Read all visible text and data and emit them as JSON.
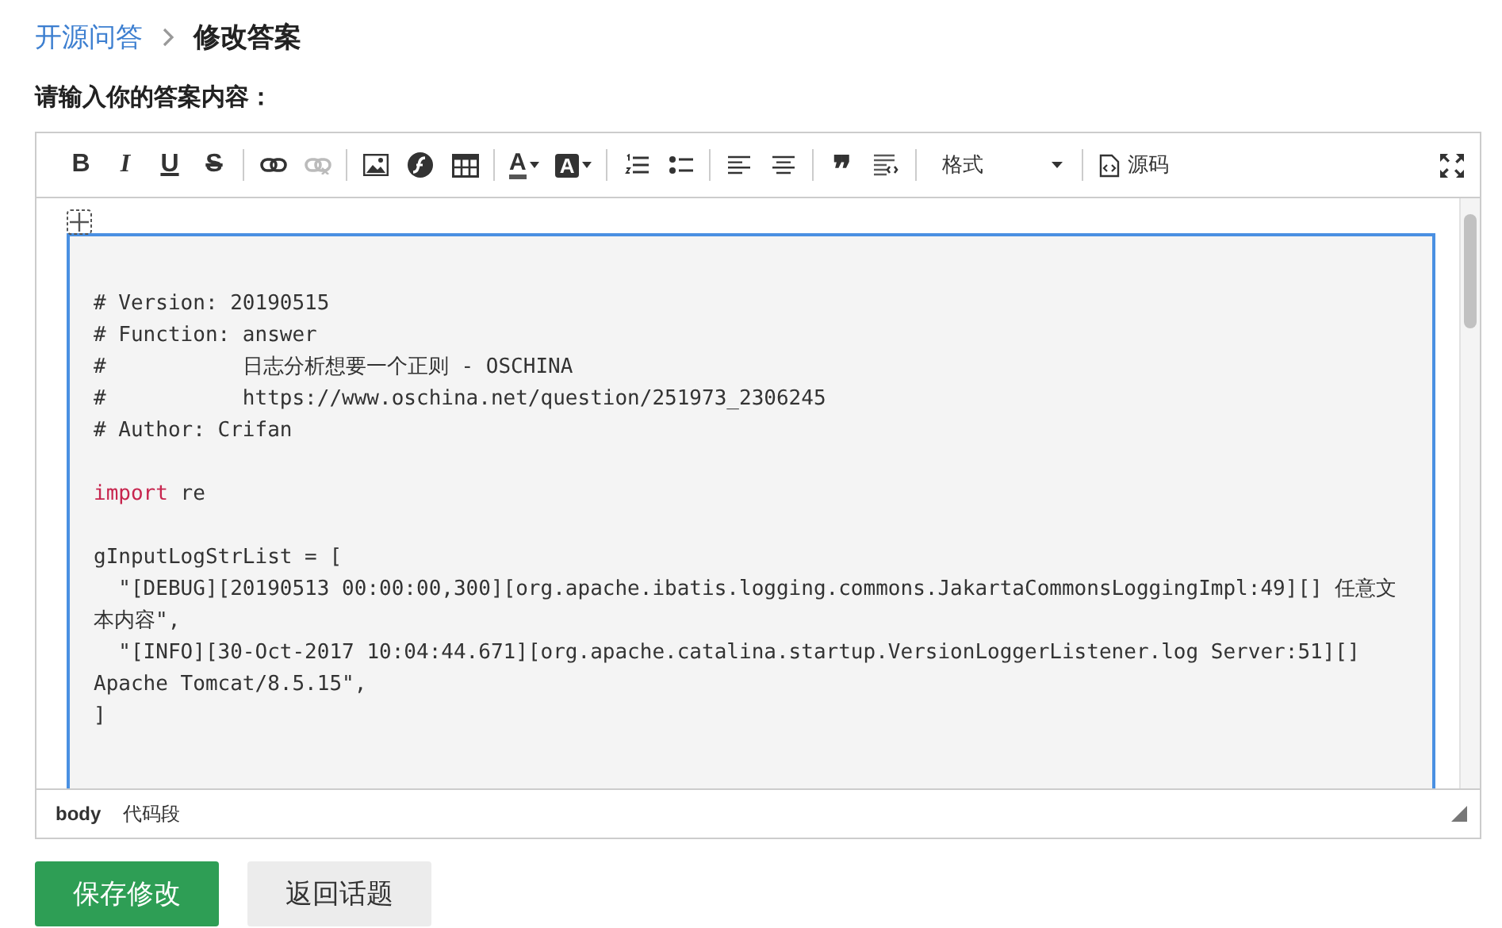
{
  "breadcrumb": {
    "parent": "开源问答",
    "current": "修改答案"
  },
  "prompt": "请输入你的答案内容：",
  "toolbar": {
    "groups": [
      [
        {
          "kind": "bold",
          "label": "B",
          "disabled": false
        },
        {
          "kind": "italic",
          "label": "I",
          "disabled": false
        },
        {
          "kind": "underline",
          "label": "U",
          "disabled": false
        },
        {
          "kind": "strike",
          "label": "S",
          "disabled": false
        }
      ],
      [
        {
          "kind": "link",
          "disabled": false
        },
        {
          "kind": "unlink",
          "disabled": true
        }
      ],
      [
        {
          "kind": "image",
          "disabled": false
        },
        {
          "kind": "flash",
          "disabled": false
        },
        {
          "kind": "table",
          "disabled": false
        }
      ],
      [
        {
          "kind": "fontcolor",
          "label": "A",
          "disabled": false
        },
        {
          "kind": "bgcolor",
          "label": "A",
          "disabled": false
        }
      ],
      [
        {
          "kind": "olist",
          "disabled": false
        },
        {
          "kind": "ulist",
          "disabled": false
        }
      ],
      [
        {
          "kind": "alignleft",
          "disabled": false
        },
        {
          "kind": "aligncenter",
          "disabled": false
        }
      ],
      [
        {
          "kind": "quote",
          "label": "❞",
          "disabled": false
        },
        {
          "kind": "codeblock",
          "disabled": false
        }
      ]
    ],
    "format": {
      "value": "格式"
    },
    "source": {
      "label": "源码"
    }
  },
  "code_lines": [
    {
      "parts": [
        {
          "kind": "plain",
          "text": "# Version: 20190515"
        }
      ]
    },
    {
      "parts": [
        {
          "kind": "plain",
          "text": "# Function: answer"
        }
      ]
    },
    {
      "parts": [
        {
          "kind": "plain",
          "text": "#           日志分析想要一个正则 - OSCHINA"
        }
      ]
    },
    {
      "parts": [
        {
          "kind": "plain",
          "text": "#           https://www.oschina.net/question/251973_2306245"
        }
      ]
    },
    {
      "parts": [
        {
          "kind": "plain",
          "text": "# Author: Crifan"
        }
      ]
    },
    {
      "kind": "blank"
    },
    {
      "parts": [
        {
          "kind": "keyword",
          "text": "import"
        },
        {
          "kind": "plain",
          "text": " re"
        }
      ]
    },
    {
      "kind": "blank"
    },
    {
      "parts": [
        {
          "kind": "plain",
          "text": "gInputLogStrList = ["
        }
      ]
    },
    {
      "parts": [
        {
          "kind": "plain",
          "text": "  \"[DEBUG][20190513 00:00:00,300][org.apache.ibatis.logging.commons.JakartaCommonsLoggingImpl:49][] 任意文本内容\","
        }
      ]
    },
    {
      "parts": [
        {
          "kind": "plain",
          "text": "  \"[INFO][30-Oct-2017 10:04:44.671][org.apache.catalina.startup.VersionLoggerListener.log Server:51][] Apache Tomcat/8.5.15\","
        }
      ]
    },
    {
      "parts": [
        {
          "kind": "plain",
          "text": "]"
        }
      ]
    }
  ],
  "status_bar": {
    "path": [
      {
        "text": "body",
        "bold": true
      },
      {
        "text": "代码段",
        "bold": false
      }
    ]
  },
  "buttons": [
    {
      "kind": "primary",
      "label": "保存修改"
    },
    {
      "kind": "secondary",
      "label": "返回话题"
    }
  ]
}
